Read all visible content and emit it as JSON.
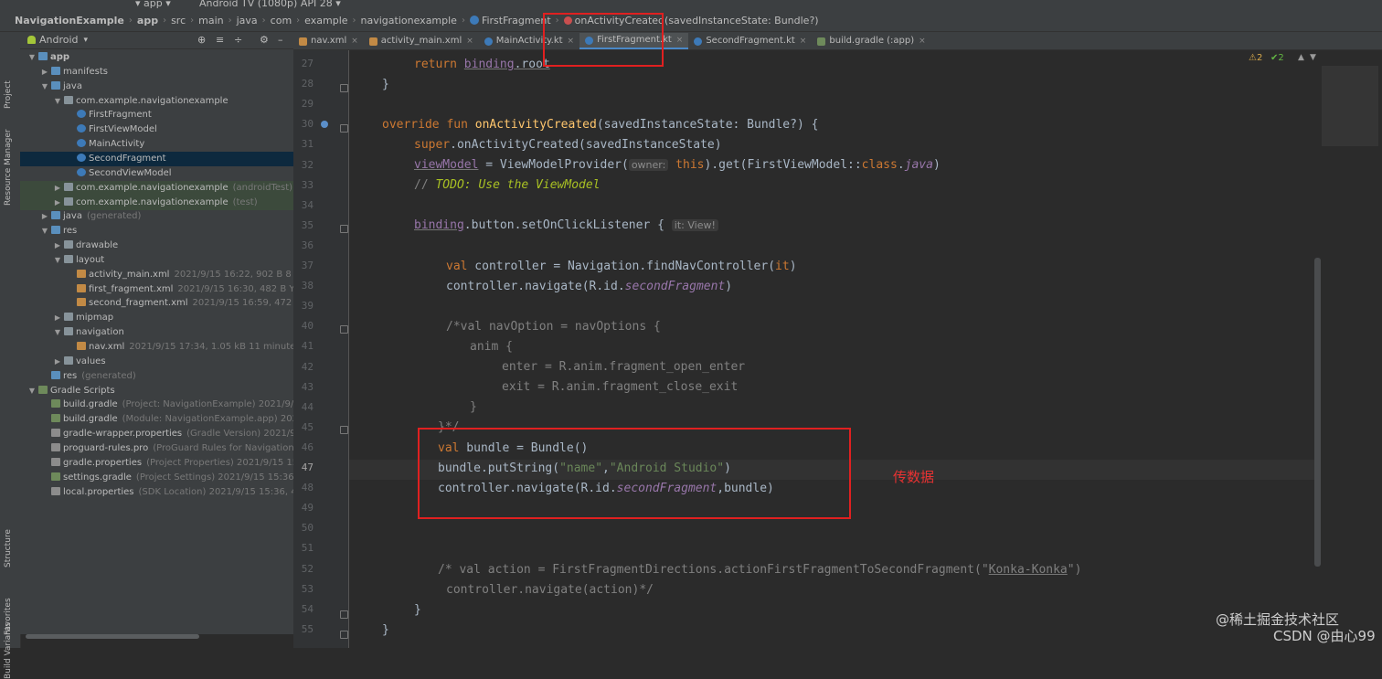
{
  "toolbar": {
    "config": "app",
    "device": "Android TV (1080p) API 28"
  },
  "breadcrumb": [
    "NavigationExample",
    "app",
    "src",
    "main",
    "java",
    "com",
    "example",
    "navigationexample",
    "FirstFragment",
    "onActivityCreated(savedInstanceState: Bundle?)"
  ],
  "project_panel": {
    "view_mode": "Android",
    "tree": [
      {
        "label": "app",
        "meta": "",
        "level": 0,
        "arrow": "v",
        "icon": "folderblue",
        "bold": true
      },
      {
        "label": "manifests",
        "meta": "",
        "level": 1,
        "arrow": ">",
        "icon": "folderblue"
      },
      {
        "label": "java",
        "meta": "",
        "level": 1,
        "arrow": "v",
        "icon": "folderblue"
      },
      {
        "label": "com.example.navigationexample",
        "meta": "",
        "level": 2,
        "arrow": "v",
        "icon": "folder"
      },
      {
        "label": "FirstFragment",
        "meta": "",
        "level": 3,
        "arrow": "",
        "icon": "kt"
      },
      {
        "label": "FirstViewModel",
        "meta": "",
        "level": 3,
        "arrow": "",
        "icon": "kt"
      },
      {
        "label": "MainActivity",
        "meta": "",
        "level": 3,
        "arrow": "",
        "icon": "kt"
      },
      {
        "label": "SecondFragment",
        "meta": "",
        "level": 3,
        "arrow": "",
        "icon": "kt",
        "selected": true
      },
      {
        "label": "SecondViewModel",
        "meta": "",
        "level": 3,
        "arrow": "",
        "icon": "kt"
      },
      {
        "label": "com.example.navigationexample",
        "meta": "(androidTest)",
        "level": 2,
        "arrow": ">",
        "icon": "folder",
        "test": true
      },
      {
        "label": "com.example.navigationexample",
        "meta": "(test)",
        "level": 2,
        "arrow": ">",
        "icon": "folder",
        "test": true
      },
      {
        "label": "java",
        "meta": "(generated)",
        "level": 1,
        "arrow": ">",
        "icon": "folderblue"
      },
      {
        "label": "res",
        "meta": "",
        "level": 1,
        "arrow": "v",
        "icon": "folderblue"
      },
      {
        "label": "drawable",
        "meta": "",
        "level": 2,
        "arrow": ">",
        "icon": "folder"
      },
      {
        "label": "layout",
        "meta": "",
        "level": 2,
        "arrow": "v",
        "icon": "folder"
      },
      {
        "label": "activity_main.xml",
        "meta": "2021/9/15 16:22, 902 B 8 minutes a",
        "level": 3,
        "arrow": "",
        "icon": "xml"
      },
      {
        "label": "first_fragment.xml",
        "meta": "2021/9/15 16:30, 482 B Yesterday",
        "level": 3,
        "arrow": "",
        "icon": "xml"
      },
      {
        "label": "second_fragment.xml",
        "meta": "2021/9/15 16:59, 472 B Yeste",
        "level": 3,
        "arrow": "",
        "icon": "xml"
      },
      {
        "label": "mipmap",
        "meta": "",
        "level": 2,
        "arrow": ">",
        "icon": "folder"
      },
      {
        "label": "navigation",
        "meta": "",
        "level": 2,
        "arrow": "v",
        "icon": "folder"
      },
      {
        "label": "nav.xml",
        "meta": "2021/9/15 17:34, 1.05 kB 11 minutes ago",
        "level": 3,
        "arrow": "",
        "icon": "xml"
      },
      {
        "label": "values",
        "meta": "",
        "level": 2,
        "arrow": ">",
        "icon": "folder"
      },
      {
        "label": "res",
        "meta": "(generated)",
        "level": 1,
        "arrow": "",
        "icon": "folderblue"
      },
      {
        "label": "Gradle Scripts",
        "meta": "",
        "level": 0,
        "arrow": "v",
        "icon": "gradle"
      },
      {
        "label": "build.gradle",
        "meta": "(Project: NavigationExample)  2021/9/15 17",
        "level": 1,
        "arrow": "",
        "icon": "gradle"
      },
      {
        "label": "build.gradle",
        "meta": "(Module: NavigationExample.app)  2021/9",
        "level": 1,
        "arrow": "",
        "icon": "gradle"
      },
      {
        "label": "gradle-wrapper.properties",
        "meta": "(Gradle Version)  2021/9/15",
        "level": 1,
        "arrow": "",
        "icon": "props"
      },
      {
        "label": "proguard-rules.pro",
        "meta": "(ProGuard Rules for NavigationEx",
        "level": 1,
        "arrow": "",
        "icon": "props"
      },
      {
        "label": "gradle.properties",
        "meta": "(Project Properties)  2021/9/15 15:36,",
        "level": 1,
        "arrow": "",
        "icon": "props"
      },
      {
        "label": "settings.gradle",
        "meta": "(Project Settings)  2021/9/15 15:36, 292 B",
        "level": 1,
        "arrow": "",
        "icon": "gradle"
      },
      {
        "label": "local.properties",
        "meta": "(SDK Location)  2021/9/15 15:36, 446 B",
        "level": 1,
        "arrow": "",
        "icon": "props"
      }
    ]
  },
  "side_tabs": [
    "Project",
    "Resource Manager",
    "Structure",
    "Favorites",
    "Build Variants"
  ],
  "editor_tabs": [
    {
      "label": "nav.xml",
      "icon": "xml",
      "active": false
    },
    {
      "label": "activity_main.xml",
      "icon": "xml",
      "active": false
    },
    {
      "label": "MainActivity.kt",
      "icon": "kt",
      "active": false
    },
    {
      "label": "FirstFragment.kt",
      "icon": "kt",
      "active": true
    },
    {
      "label": "SecondFragment.kt",
      "icon": "kt",
      "active": false
    },
    {
      "label": "build.gradle (:app)",
      "icon": "gradle",
      "active": false
    }
  ],
  "inspections": {
    "warnings": "2",
    "weak_warnings": "2"
  },
  "line_numbers": [
    "27",
    "28",
    "29",
    "30",
    "31",
    "32",
    "33",
    "34",
    "35",
    "36",
    "37",
    "38",
    "39",
    "40",
    "41",
    "42",
    "43",
    "44",
    "45",
    "46",
    "47",
    "48",
    "49",
    "50",
    "51",
    "52",
    "53",
    "54",
    "55"
  ],
  "code": {
    "l27_return": "return",
    "l27_binding": "binding",
    "l27_root": ".root",
    "l28": "}",
    "l30_override": "override fun",
    "l30_name": "onActivityCreated",
    "l30_rest": "(savedInstanceState: Bundle?) {",
    "l31_super": "super",
    "l31_rest": ".onActivityCreated(savedInstanceState)",
    "l32_vm": "viewModel",
    "l32_a": " = ViewModelProvider(",
    "l32_hint": "owner:",
    "l32_this": " this",
    "l32_b": ").get(FirstViewModel::",
    "l32_class": "class",
    "l32_c": ".",
    "l32_java": "java",
    "l32_d": ")",
    "l33_slash": "// ",
    "l33_todo": "TODO: Use the ViewModel",
    "l35_binding": "binding",
    "l35_rest": ".button.setOnClickListener {",
    "l35_hint": "it: View!",
    "l37_val": "val",
    "l37_rest": " controller = Navigation.findNavController(",
    "l37_it": "it",
    "l37_end": ")",
    "l38_a": "controller.navigate(R.id.",
    "l38_b": "secondFragment",
    "l38_c": ")",
    "l40": "/*val navOption = navOptions {",
    "l41": "anim {",
    "l42": "enter = R.anim.fragment_open_enter",
    "l43": "exit = R.anim.fragment_close_exit",
    "l44": "}",
    "l45": "}*/",
    "l46_val": "val",
    "l46_rest": " bundle = Bundle()",
    "l47_a": "bundle.putString(",
    "l47_s1": "\"name\"",
    "l47_comma": ",",
    "l47_s2": "\"Android Studio\"",
    "l47_b": ")",
    "l48_a": "controller.navigate(R.id.",
    "l48_b": "secondFragment",
    "l48_c": ",bundle)",
    "l52_a": "/* val action = FirstFragmentDirections.actionFirstFragmentToSecondFragment(\"",
    "l52_b": "Konka-Konka",
    "l52_c": "\")",
    "l53": "controller.navigate(action)*/",
    "l54": "}",
    "l55": "}"
  },
  "annotation": "传数据",
  "watermarks": [
    "@稀土掘金技术社区",
    "CSDN @由心99"
  ],
  "colors": {
    "annotation_red": "#e02020",
    "keyword": "#cc7832",
    "function": "#ffc66d",
    "string": "#6a8759",
    "property": "#9876aa"
  }
}
